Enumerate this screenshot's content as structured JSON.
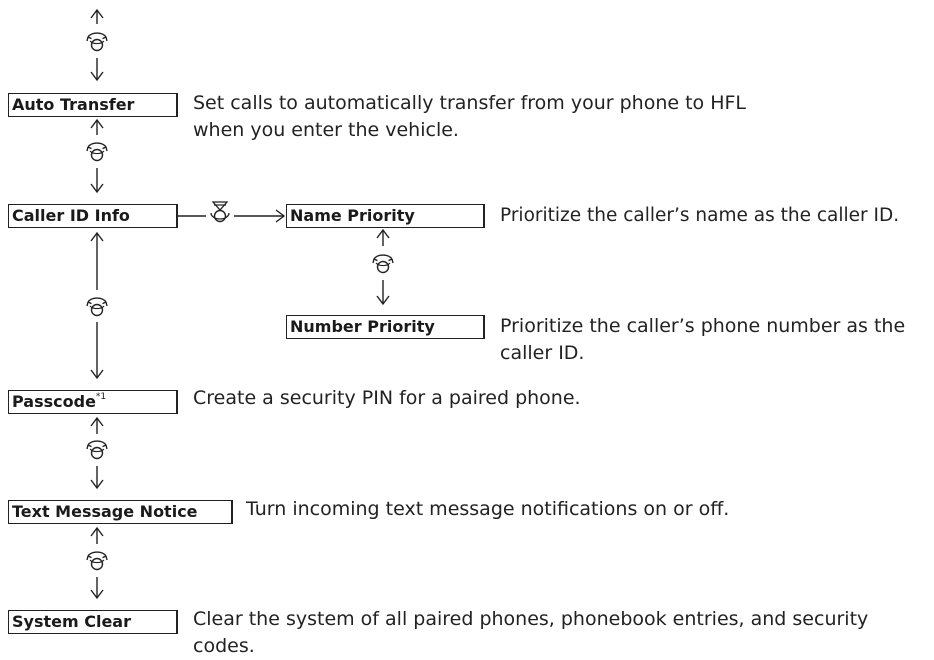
{
  "items": {
    "auto_transfer": {
      "label": "Auto Transfer",
      "desc": "Set calls to automatically transfer from your phone to HFL when you enter the vehicle."
    },
    "caller_id": {
      "label": "Caller ID Info"
    },
    "name_priority": {
      "label": "Name Priority",
      "desc": "Prioritize the caller’s name as the caller ID."
    },
    "number_priority": {
      "label": "Number Priority",
      "desc": "Prioritize the caller’s phone number as the caller ID."
    },
    "passcode": {
      "label": "Passcode",
      "footnote": "*1",
      "desc": "Create a security PIN for a paired phone."
    },
    "text_notice": {
      "label": "Text Message Notice",
      "desc": "Turn incoming text message notifications on or off."
    },
    "system_clear": {
      "label": "System Clear",
      "desc": "Clear the system of all paired phones, phonebook entries, and security codes."
    }
  },
  "icons": {
    "rotate": "selector-knob-rotate-icon",
    "press": "selector-knob-press-icon"
  },
  "colors": {
    "ink": "#222222",
    "background": "#ffffff"
  }
}
